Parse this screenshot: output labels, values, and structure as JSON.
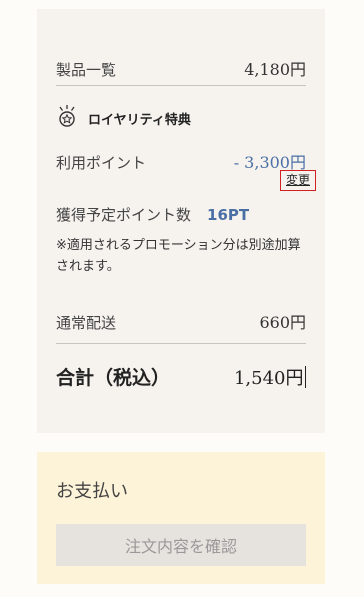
{
  "summary": {
    "products_label": "製品一覧",
    "products_price": "4,180円",
    "loyalty_title": "ロイヤリティ特典",
    "points_used_label": "利用ポイント",
    "points_used_value": "- 3,300円",
    "change_label": "変更",
    "points_earned_label": "獲得予定ポイント数",
    "points_earned_value": "16PT",
    "note": "※適用されるプロモーション分は別途加算されます。",
    "shipping_label": "通常配送",
    "shipping_price": "660円",
    "total_label": "合計（税込）",
    "total_price": "1,540円"
  },
  "payment": {
    "title": "お支払い",
    "confirm_label": "注文内容を確認"
  },
  "colors": {
    "summary_bg": "#f6f3ef",
    "payment_bg": "#fdf3d8",
    "accent_blue": "#4a6fa5",
    "highlight_red": "#d32020",
    "button_bg": "#e6e2de"
  },
  "icons": {
    "loyalty": "medal-star-icon"
  }
}
